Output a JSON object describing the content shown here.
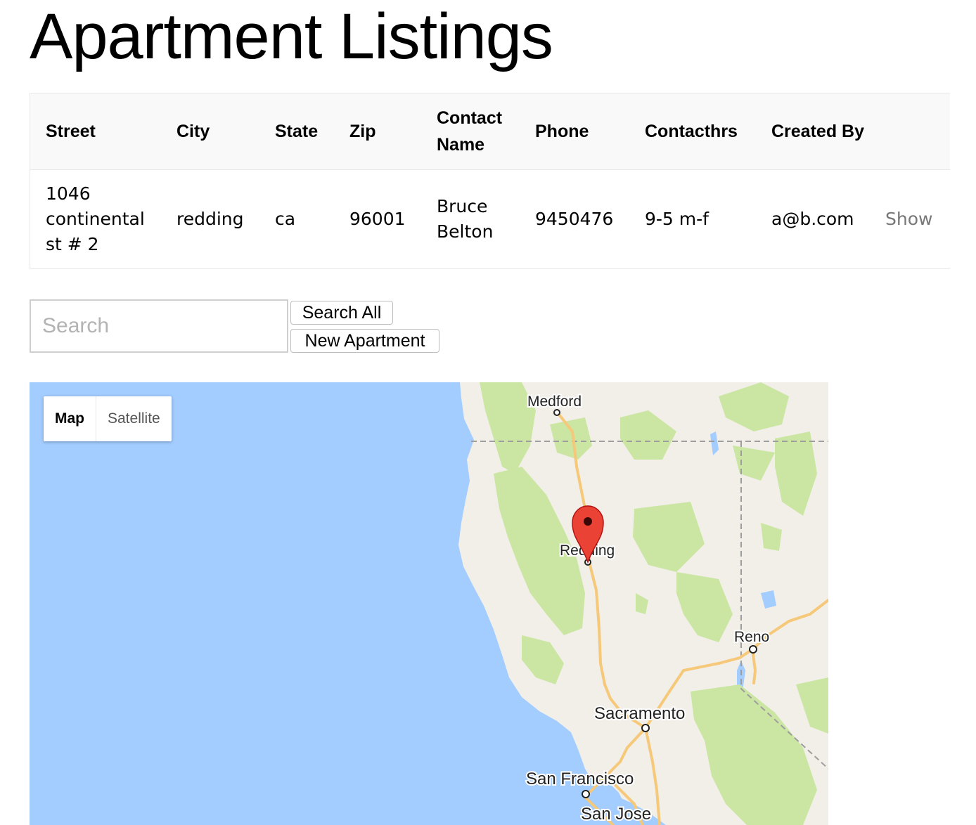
{
  "page": {
    "title": "Apartment Listings"
  },
  "table": {
    "headers": [
      "Street",
      "City",
      "State",
      "Zip",
      "Contact Name",
      "Phone",
      "Contacthrs",
      "Created By"
    ],
    "rows": [
      {
        "street": "1046 continental st # 2",
        "city": "redding",
        "state": "ca",
        "zip": "96001",
        "contact_name": "Bruce Belton",
        "phone": "9450476",
        "contacthrs": "9-5 m-f",
        "created_by": "a@b.com",
        "action": "Show"
      }
    ]
  },
  "search": {
    "placeholder": "Search",
    "value": "",
    "search_all_label": "Search All",
    "new_apartment_label": "New Apartment"
  },
  "map": {
    "type_control": {
      "map_label": "Map",
      "satellite_label": "Satellite",
      "selected": "Map"
    },
    "cities": {
      "medford": "Medford",
      "redding": "Redding",
      "reno": "Reno",
      "sacramento": "Sacramento",
      "san_francisco": "San Francisco",
      "san_jose": "San Jose"
    },
    "marker_icon": "map-pin-icon",
    "colors": {
      "water": "#a3ccff",
      "land": "#f2efe9",
      "forest": "#cbe6a3",
      "highway": "#f6c879",
      "marker": "#ea4335"
    }
  }
}
